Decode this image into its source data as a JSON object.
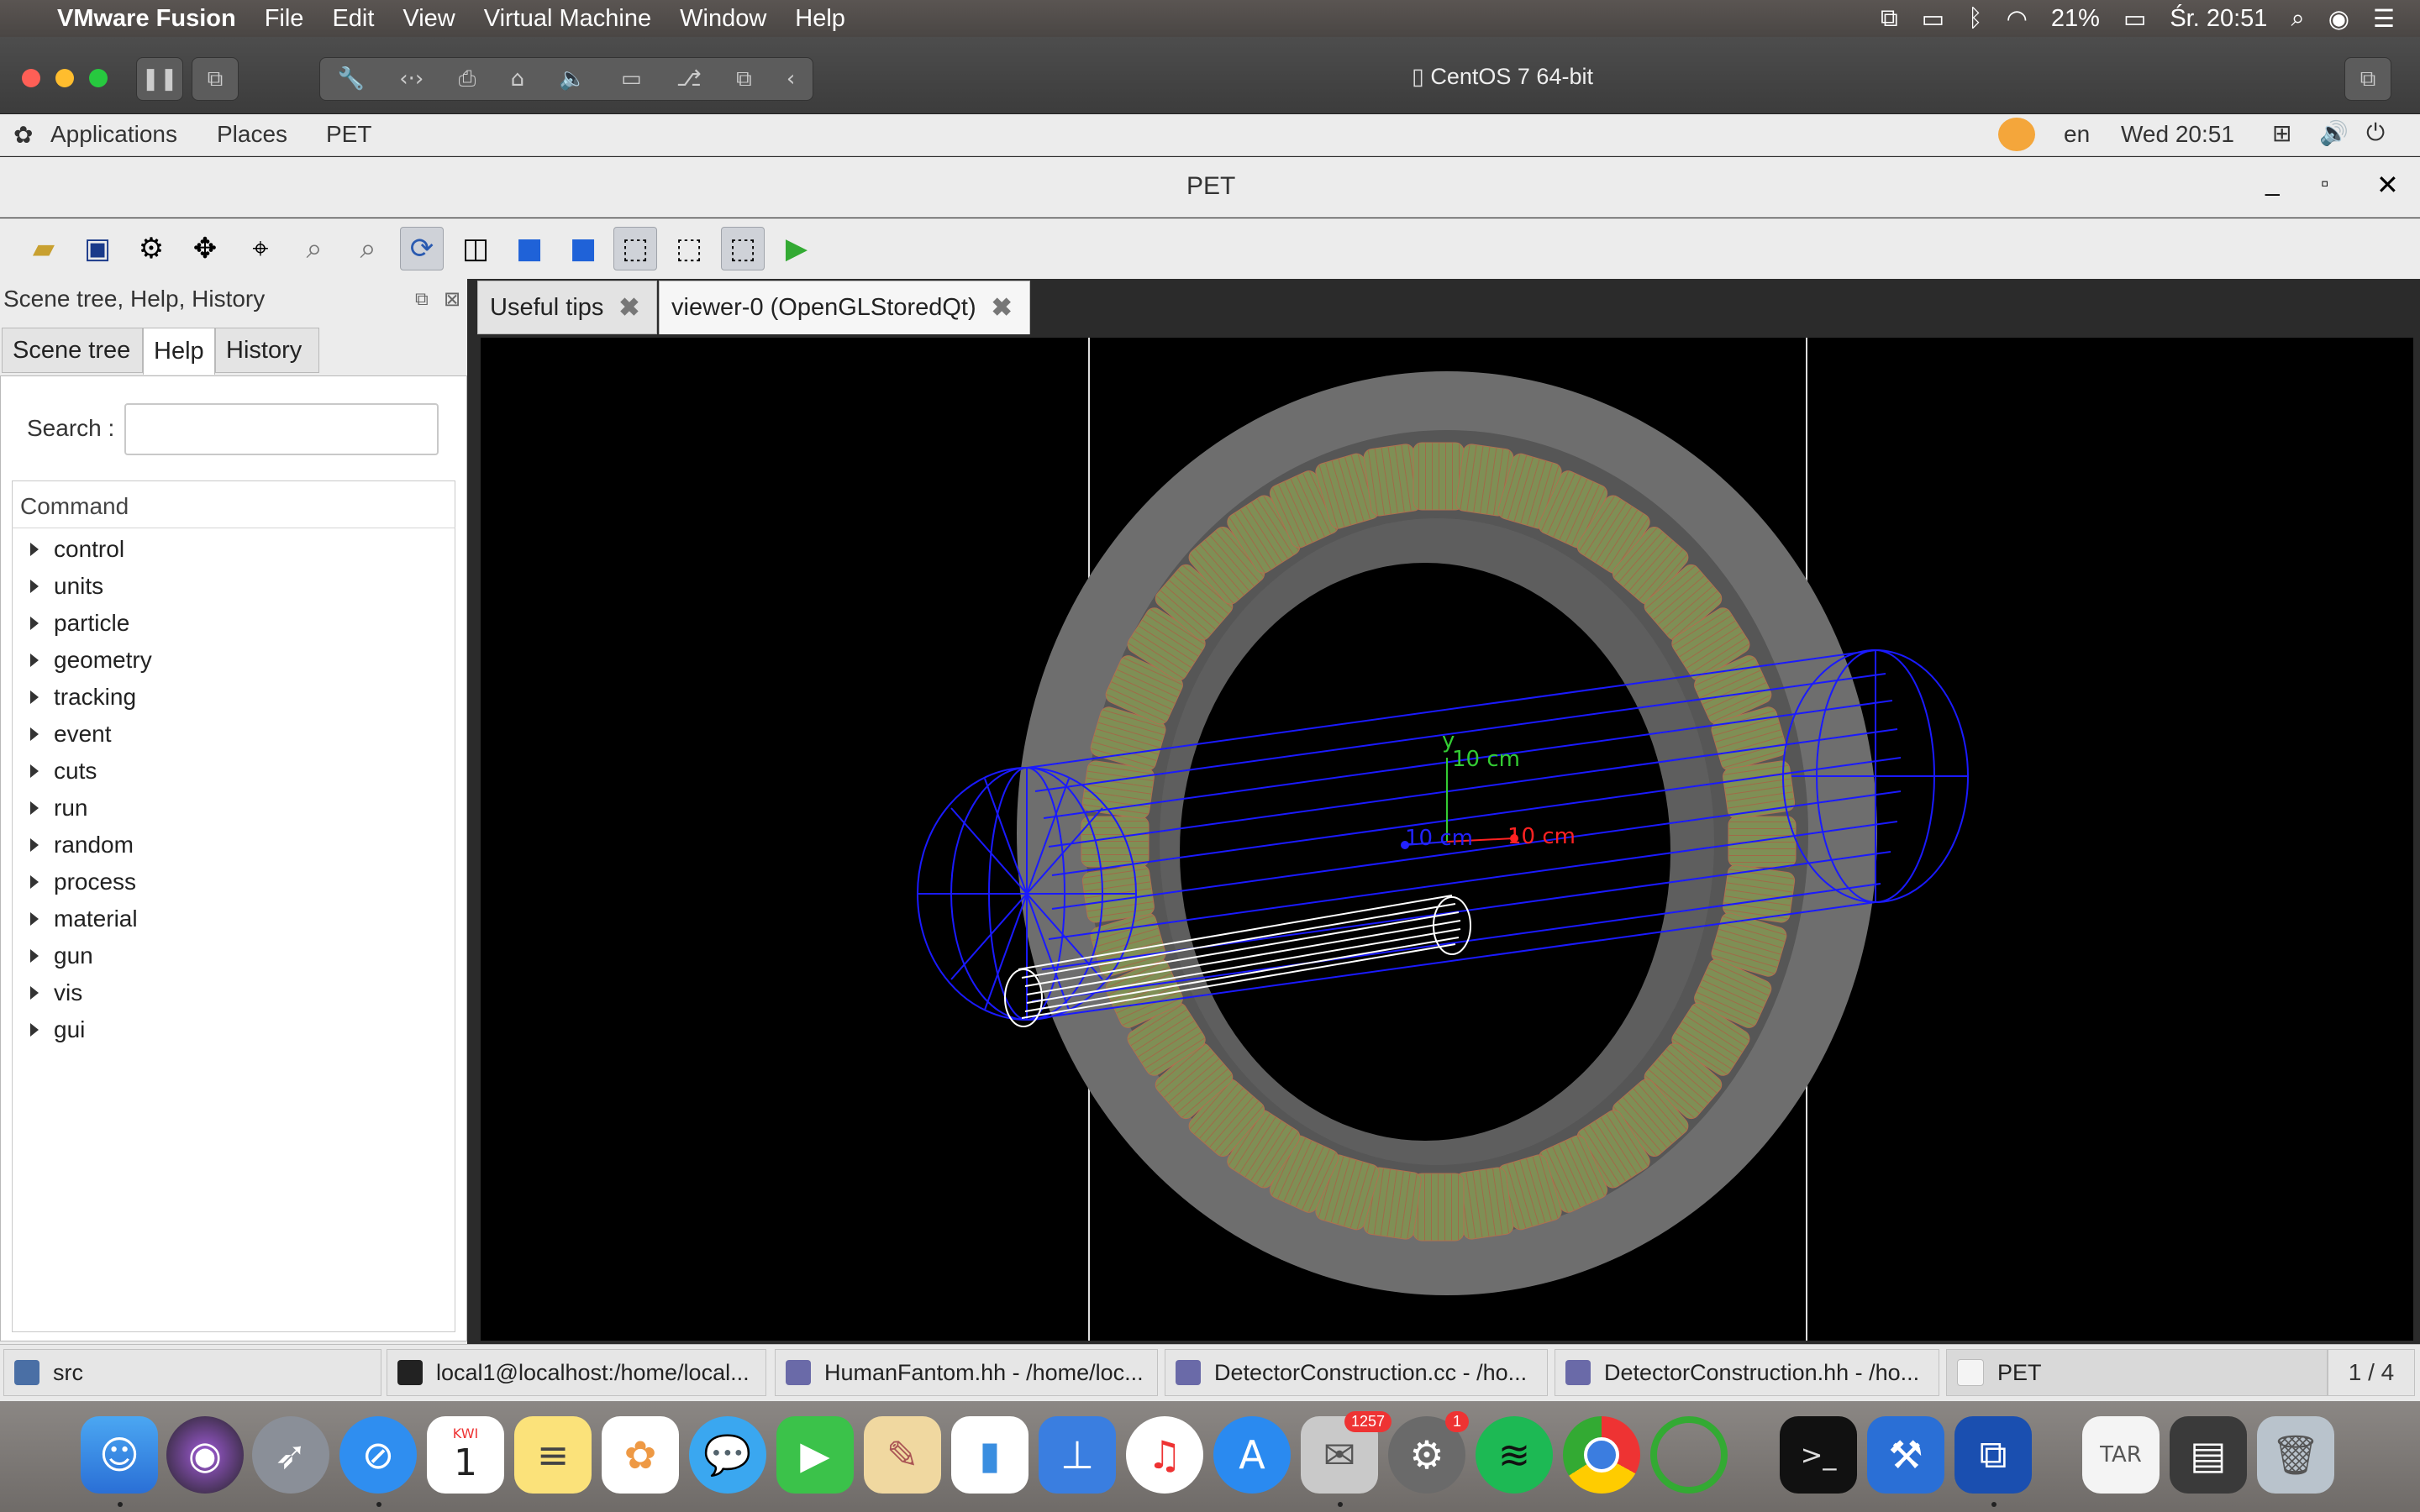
{
  "mac_menubar": {
    "app_name": "VMware Fusion",
    "menus": [
      "File",
      "Edit",
      "View",
      "Virtual Machine",
      "Window",
      "Help"
    ],
    "battery": "21%",
    "clock": "Śr. 20:51"
  },
  "vm_window": {
    "title": "CentOS 7 64-bit"
  },
  "gnome": {
    "menus": [
      "Applications",
      "Places",
      "PET"
    ],
    "lang": "en",
    "clock": "Wed 20:51"
  },
  "pet_window": {
    "title": "PET"
  },
  "left_panel": {
    "title": "Scene tree, Help, History",
    "tabs": [
      "Scene tree",
      "Help",
      "History"
    ],
    "search_label": "Search :",
    "search_value": "",
    "column_header": "Command",
    "commands": [
      "control",
      "units",
      "particle",
      "geometry",
      "tracking",
      "event",
      "cuts",
      "run",
      "random",
      "process",
      "material",
      "gun",
      "vis",
      "gui"
    ]
  },
  "viewer_tabs": [
    {
      "label": "Useful tips"
    },
    {
      "label": "viewer-0 (OpenGLStoredQt)"
    }
  ],
  "viewer": {
    "axis_y_label": "y",
    "axis_y_scale": "10 cm",
    "axis_z_scale": "10 cm",
    "axis_x_scale": "10 cm"
  },
  "taskbar": {
    "items": [
      "src",
      "local1@localhost:/home/local...",
      "HumanFantom.hh - /home/loc...",
      "DetectorConstruction.cc - /ho...",
      "DetectorConstruction.hh - /ho...",
      "PET"
    ],
    "workspace": "1 / 4"
  },
  "dock": {
    "calendar_month": "KWI",
    "calendar_day": "1",
    "mail_badge": "1257",
    "prefs_badge": "1"
  },
  "colors": {
    "gnome_bg": "#ececec",
    "viewer_bg": "#000000",
    "detector_crystal": "#8a9a5a",
    "phantom_wire": "#1a1aff"
  }
}
